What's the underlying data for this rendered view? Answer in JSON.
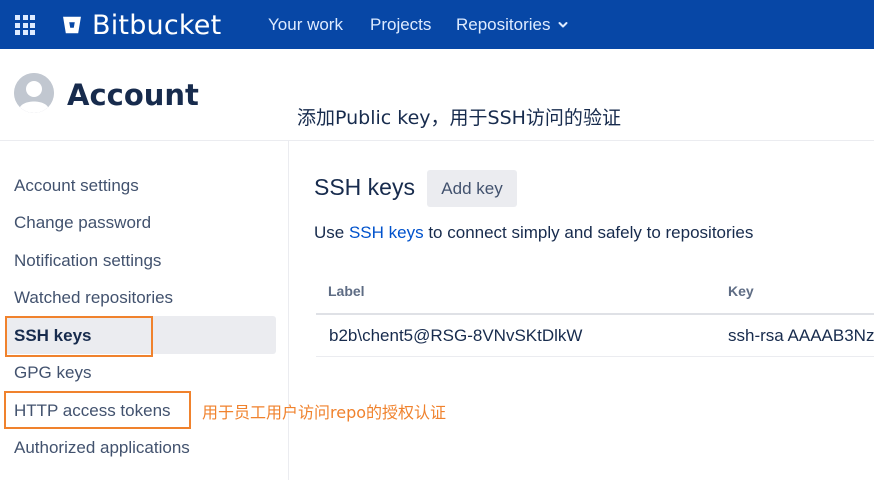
{
  "topnav": {
    "app_switcher_icon": "grid-icon",
    "logo_icon": "bitbucket-bucket-icon",
    "brand": "Bitbucket",
    "links": [
      "Your work",
      "Projects",
      "Repositories"
    ],
    "dropdown_icon": "chevron-down-icon",
    "background_color": "#0747a6"
  },
  "header": {
    "avatar_icon": "default-user-avatar-icon",
    "title": "Account",
    "annotation": "添加Public key，用于SSH访问的验证"
  },
  "sidebar": {
    "items": [
      {
        "label": "Account settings"
      },
      {
        "label": "Change password"
      },
      {
        "label": "Notification settings"
      },
      {
        "label": "Watched repositories"
      },
      {
        "label": "SSH keys",
        "active": true
      },
      {
        "label": "GPG keys"
      },
      {
        "label": "HTTP access tokens"
      },
      {
        "label": "Authorized applications"
      }
    ],
    "annotation": "用于员工用户访问repo的授权认证",
    "highlight_color": "#f0822d"
  },
  "main": {
    "title": "SSH keys",
    "add_button": "Add key",
    "description_prefix": "Use ",
    "description_link": "SSH keys",
    "description_suffix": " to connect simply and safely to repositories",
    "table": {
      "columns": [
        "Label",
        "Key"
      ],
      "rows": [
        {
          "label": "b2b\\chent5@RSG-8VNvSKtDlkW",
          "key": "ssh-rsa AAAAB3Nza"
        }
      ]
    }
  }
}
